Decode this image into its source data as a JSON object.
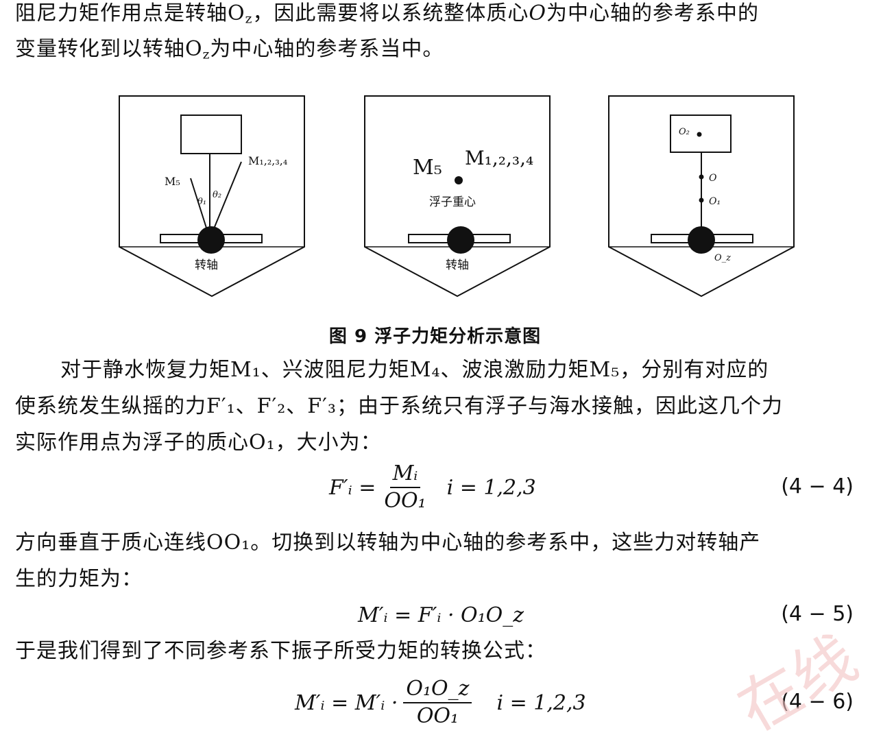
{
  "paragraph1": {
    "line1": "阻尼力矩作用点是转轴O",
    "line1_sub": "z",
    "line1_b": "，因此需要将以系统整体质心",
    "line1_O": "O",
    "line1_c": "为中心轴的参考系中的",
    "line2": "变量转化到以转轴O",
    "line2_sub": "z",
    "line2_b": "为中心轴的参考系当中。"
  },
  "figure": {
    "panel1": {
      "label_m5": "M₅",
      "label_m1234": "M₁,₂,₃,₄",
      "theta1": "θ₁",
      "theta2": "θ₂",
      "axis_label": "转轴"
    },
    "panel2": {
      "label_m5": "M₅",
      "label_m1234": "M₁,₂,₃,₄",
      "center_label": "浮子重心",
      "axis_label": "转轴"
    },
    "panel3": {
      "label_o2": "O₂",
      "label_o": "O",
      "label_o1": "O₁",
      "label_oz": "O_z"
    }
  },
  "caption": "图 9  浮子力矩分析示意图",
  "paragraph2": {
    "line1": "对于静水恢复力矩M₁、兴波阻尼力矩M₄、波浪激励力矩M₅，分别有对应的",
    "line2": "使系统发生纵摇的力F′₁、F′₂、F′₃；由于系统只有浮子与海水接触，因此这几个力",
    "line3": "实际作用点为浮子的质心O₁，大小为："
  },
  "eq44": {
    "lhs": "F′ᵢ =",
    "num": "Mᵢ",
    "den": "OO₁",
    "cond": "i = 1,2,3",
    "number": "(4 − 4)"
  },
  "paragraph3": {
    "line1": "方向垂直于质心连线OO₁。切换到以转轴为中心轴的参考系中，这些力对转轴产",
    "line2": "生的力矩为："
  },
  "eq45": {
    "expr": "M′ᵢ = F′ᵢ · O₁O_z",
    "number": "(4 − 5)"
  },
  "paragraph4": {
    "line1": "于是我们得到了不同参考系下振子所受力矩的转换公式："
  },
  "eq46": {
    "lhs": "M′ᵢ = M′ᵢ ·",
    "num": "O₁O_z",
    "den": "OO₁",
    "cond": "i = 1,2,3",
    "number": "(4 − 6)"
  },
  "watermark": "在线"
}
